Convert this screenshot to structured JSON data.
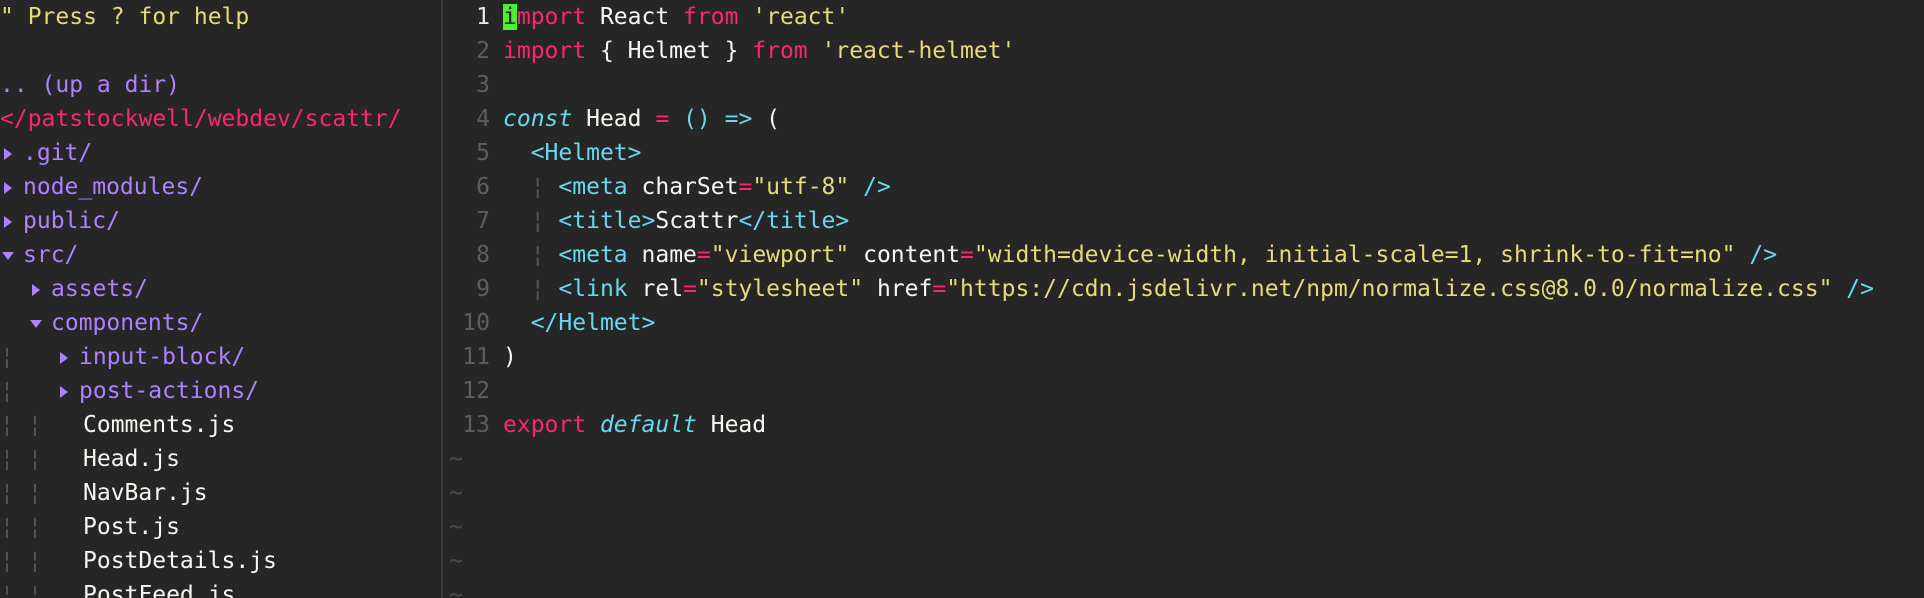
{
  "window": {
    "theme_colors": {
      "background": "#262626",
      "keyword": "#f92672",
      "string": "#e6db74",
      "tag": "#66d9ef",
      "directory": "#ae81ff",
      "line_number": "#5e5e5e",
      "cursor": "#4cf02d"
    }
  },
  "tree": {
    "help_text": "\" Press ? for help",
    "up_dir": ".. (up a dir)",
    "cwd": "</patstockwell/webdev/scattr/",
    "items": [
      {
        "label": ".git/",
        "kind": "dir",
        "expanded": false
      },
      {
        "label": "node_modules/",
        "kind": "dir",
        "expanded": false
      },
      {
        "label": "public/",
        "kind": "dir",
        "expanded": false
      },
      {
        "label": "src/",
        "kind": "dir",
        "expanded": true
      },
      {
        "label": "assets/",
        "kind": "dir",
        "expanded": false
      },
      {
        "label": "components/",
        "kind": "dir",
        "expanded": true
      },
      {
        "label": "input-block/",
        "kind": "dir",
        "expanded": false
      },
      {
        "label": "post-actions/",
        "kind": "dir",
        "expanded": false
      },
      {
        "label": "Comments.js",
        "kind": "file"
      },
      {
        "label": "Head.js",
        "kind": "file"
      },
      {
        "label": "NavBar.js",
        "kind": "file"
      },
      {
        "label": "Post.js",
        "kind": "file"
      },
      {
        "label": "PostDetails.js",
        "kind": "file"
      },
      {
        "label": "PostFeed.js",
        "kind": "file"
      }
    ]
  },
  "editor": {
    "tilde": "~",
    "guide": "¦",
    "lines": [
      {
        "n": "1",
        "c": [
          "i",
          "mport",
          " React ",
          "from",
          " ",
          "'react'"
        ]
      },
      {
        "n": "2",
        "c": [
          "import",
          " { Helmet } ",
          "from",
          " ",
          "'react-helmet'"
        ]
      },
      {
        "n": "3",
        "c": []
      },
      {
        "n": "4",
        "c": [
          "const",
          " Head ",
          "=",
          " ",
          "()",
          " ",
          "=>",
          " ("
        ]
      },
      {
        "n": "5",
        "c": [
          "  ",
          "<Helmet>"
        ]
      },
      {
        "n": "6",
        "c": [
          "<meta",
          " charSet",
          "=",
          "\"utf-8\"",
          " />"
        ]
      },
      {
        "n": "7",
        "c": [
          "<title>",
          "Scattr",
          "</title>"
        ]
      },
      {
        "n": "8",
        "c": [
          "<meta",
          " name",
          "=",
          "\"viewport\"",
          " content",
          "=",
          "\"width=device-width, initial-scale=1, shrink-to-fit=no\"",
          " />"
        ]
      },
      {
        "n": "9",
        "c": [
          "<link",
          " rel",
          "=",
          "\"stylesheet\"",
          " href",
          "=",
          "\"https://cdn.jsdelivr.net/npm/normalize.css@8.0.0/normalize.css\"",
          " />"
        ]
      },
      {
        "n": "10",
        "c": [
          "  ",
          "</Helmet>"
        ]
      },
      {
        "n": "11",
        "c": [
          ")"
        ]
      },
      {
        "n": "12",
        "c": []
      },
      {
        "n": "13",
        "c": [
          "export",
          " ",
          "default",
          " Head"
        ]
      }
    ]
  }
}
